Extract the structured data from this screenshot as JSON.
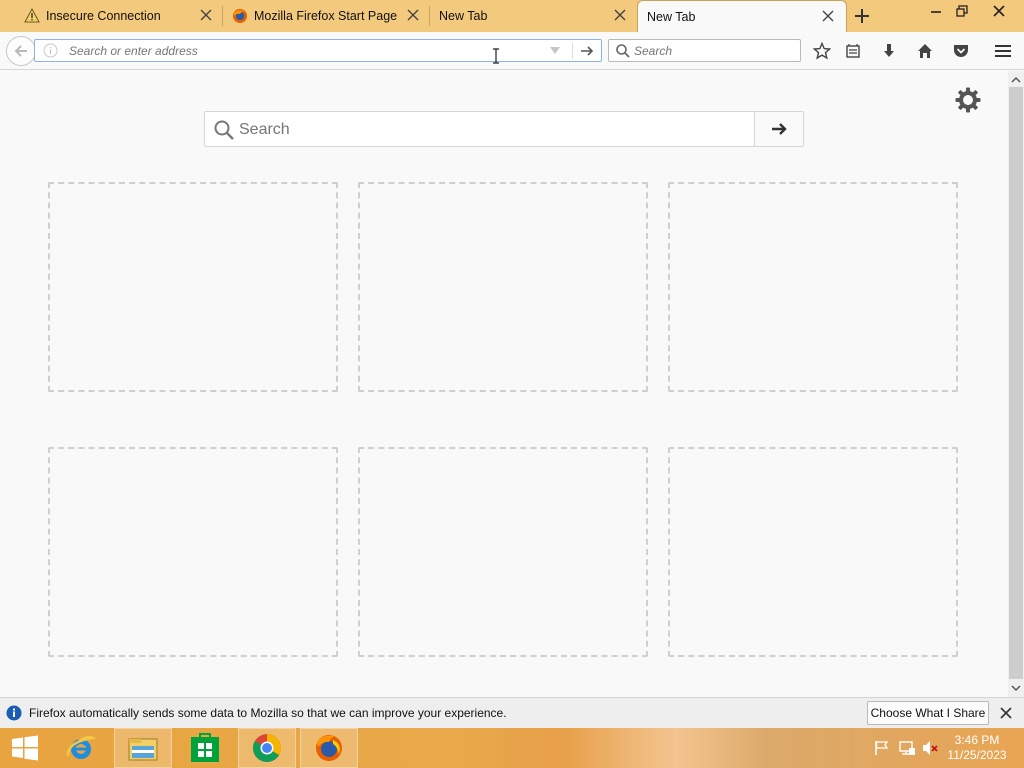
{
  "tabs": [
    {
      "title": "Insecure Connection",
      "icon": "warning-icon"
    },
    {
      "title": "Mozilla Firefox Start Page",
      "icon": "firefox-icon"
    },
    {
      "title": "New Tab",
      "icon": ""
    },
    {
      "title": "New Tab",
      "icon": "",
      "selected": true
    }
  ],
  "window_controls": {
    "minimize": "minimize-icon",
    "maximize": "maximize-icon",
    "close": "close-icon"
  },
  "navbar": {
    "url_placeholder": "Search or enter address",
    "search_placeholder": "Search"
  },
  "content": {
    "search_placeholder": "Search",
    "tile_count": 6
  },
  "notification": {
    "message": "Firefox automatically sends some data to Mozilla so that we can improve your experience.",
    "button_label": "Choose What I Share"
  },
  "taskbar": {
    "items": [
      "start-icon",
      "internet-explorer-icon",
      "file-explorer-icon",
      "store-icon",
      "chrome-icon",
      "firefox-icon"
    ],
    "clock_time": "3:46 PM",
    "clock_date": "11/25/2023"
  },
  "colors": {
    "tabstrip": "#f3c97e",
    "taskbar": "#e7a43f",
    "url_focus_border": "#8fb4e3"
  }
}
